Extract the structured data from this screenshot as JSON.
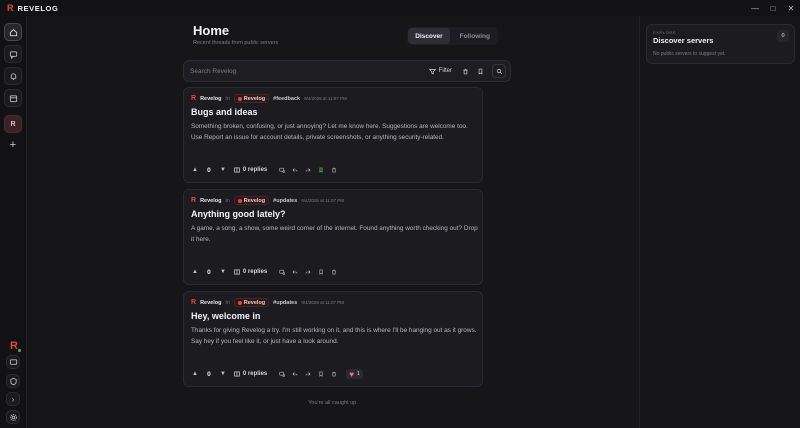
{
  "app": {
    "logo_glyph": "R",
    "name": "REVELOG",
    "accent": "#e8463b"
  },
  "window_controls": {
    "minimize": "—",
    "maximize": "□",
    "close": "✕"
  },
  "rail": {
    "server_initial": "R",
    "add_glyph": "+",
    "user_logo_glyph": "R",
    "expand_glyph": "›"
  },
  "header": {
    "title": "Home",
    "subtitle": "Recent threads from public servers",
    "tabs": [
      {
        "label": "Discover",
        "active": true
      },
      {
        "label": "Following",
        "active": false
      }
    ]
  },
  "search": {
    "placeholder": "Search Revelog",
    "filter_label": "Filter"
  },
  "posts": [
    {
      "logo_glyph": "R",
      "author": "Revelog",
      "in_label": "in",
      "server": "Revelog",
      "tag": "#feedback",
      "date": "9/4/2026 at 11:07 PM",
      "title": "Bugs and ideas",
      "body": "Something broken, confusing, or just annoying? Let me know here. Suggestions are welcome too. Use Report an issue for account details, private screenshots, or anything security-related.",
      "votes": "0",
      "replies": "0 replies"
    },
    {
      "logo_glyph": "R",
      "author": "Revelog",
      "in_label": "in",
      "server": "Revelog",
      "tag": "#updates",
      "date": "9/4/2026 at 11:07 PM",
      "title": "Anything good lately?",
      "body": "A game, a song, a show, some weird corner of the internet. Found anything worth checking out? Drop it here.",
      "votes": "0",
      "replies": "0 replies"
    },
    {
      "logo_glyph": "R",
      "author": "Revelog",
      "in_label": "in",
      "server": "Revelog",
      "tag": "#updates",
      "date": "9/4/2026 at 11:07 PM",
      "title": "Hey, welcome in",
      "body": "Thanks for giving Revelog a try. I'm still working on it, and this is where I'll be hanging out as it grows. Say hey if you feel like it, or just have a look around.",
      "votes": "0",
      "replies": "0 replies",
      "reaction": {
        "emoji": "♥",
        "count": "1"
      }
    }
  ],
  "feed_end": "You're all caught up.",
  "explore": {
    "eyebrow": "EXPLORE",
    "title": "Discover servers",
    "count": "0",
    "empty": "No public servers to suggest yet."
  }
}
